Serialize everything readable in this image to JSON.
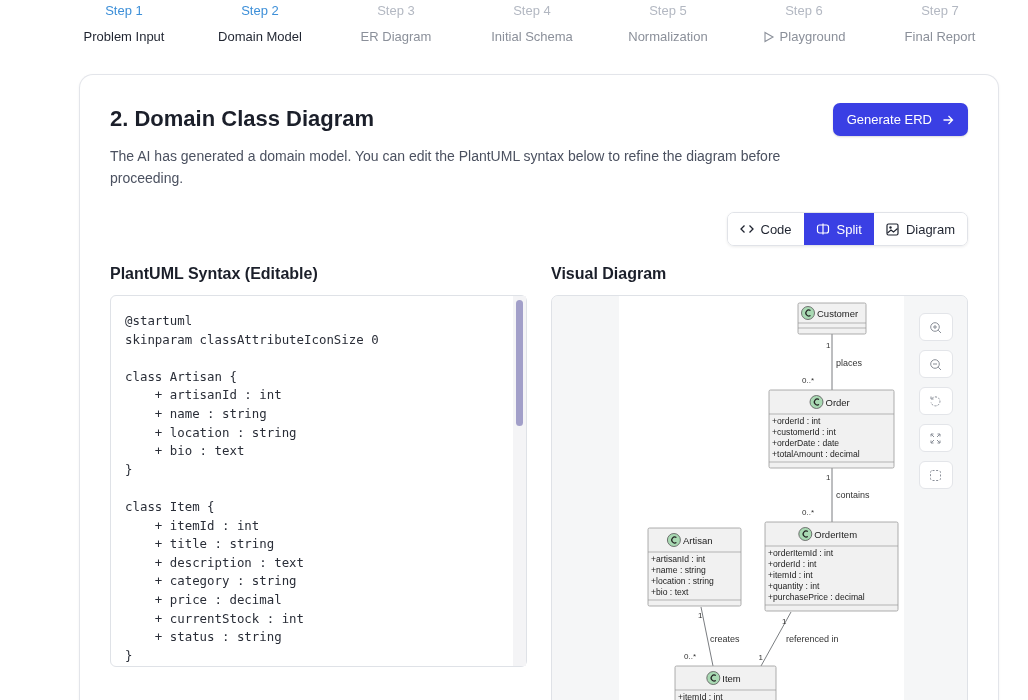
{
  "stepper": [
    {
      "step": "Step 1",
      "label": "Problem Input",
      "active": true,
      "kind": "plain"
    },
    {
      "step": "Step 2",
      "label": "Domain Model",
      "active": true,
      "kind": "plain"
    },
    {
      "step": "Step 3",
      "label": "ER Diagram",
      "active": false,
      "kind": "plain"
    },
    {
      "step": "Step 4",
      "label": "Initial Schema",
      "active": false,
      "kind": "plain"
    },
    {
      "step": "Step 5",
      "label": "Normalization",
      "active": false,
      "kind": "plain"
    },
    {
      "step": "Step 6",
      "label": "Playground",
      "active": false,
      "kind": "with-icon"
    },
    {
      "step": "Step 7",
      "label": "Final Report",
      "active": false,
      "kind": "plain"
    }
  ],
  "card": {
    "title": "2. Domain Class Diagram",
    "description": "The AI has generated a domain model. You can edit the PlantUML syntax below to refine the diagram before proceeding.",
    "button": "Generate ERD"
  },
  "view_modes": [
    {
      "label": "Code",
      "selected": false,
      "kind": "code"
    },
    {
      "label": "Split",
      "selected": true,
      "kind": "split"
    },
    {
      "label": "Diagram",
      "selected": false,
      "kind": "diagram"
    }
  ],
  "editor": {
    "heading": "PlantUML Syntax (Editable)",
    "code": "@startuml\nskinparam classAttributeIconSize 0\n\nclass Artisan {\n    + artisanId : int\n    + name : string\n    + location : string\n    + bio : text\n}\n\nclass Item {\n    + itemId : int\n    + title : string\n    + description : text\n    + category : string\n    + price : decimal\n    + currentStock : int\n    + status : string\n}"
  },
  "diagram": {
    "heading": "Visual Diagram",
    "classes": [
      {
        "name": "Customer"
      },
      {
        "name": "Order",
        "attributes": [
          "+orderId : int",
          "+customerId : int",
          "+orderDate : date",
          "+totalAmount : decimal"
        ]
      },
      {
        "name": "Artisan",
        "attributes": [
          "+artisanId : int",
          "+name : string",
          "+location : string",
          "+bio : text"
        ]
      },
      {
        "name": "OrderItem",
        "attributes": [
          "+orderItemId : int",
          "+orderId : int",
          "+itemId : int",
          "+quantity : int",
          "+purchasePrice : decimal"
        ]
      },
      {
        "name": "Item",
        "attributes": [
          "+itemId : int"
        ]
      }
    ],
    "relations": [
      {
        "label": "places",
        "from_multiplicity": "1",
        "to_multiplicity": "0..*"
      },
      {
        "label": "contains",
        "from_multiplicity": "1",
        "to_multiplicity": "0..*"
      },
      {
        "label": "creates",
        "from_multiplicity": "1",
        "to_multiplicity": "0..*"
      },
      {
        "label": "referenced in",
        "from_multiplicity": "1",
        "to_multiplicity": "1"
      }
    ]
  }
}
